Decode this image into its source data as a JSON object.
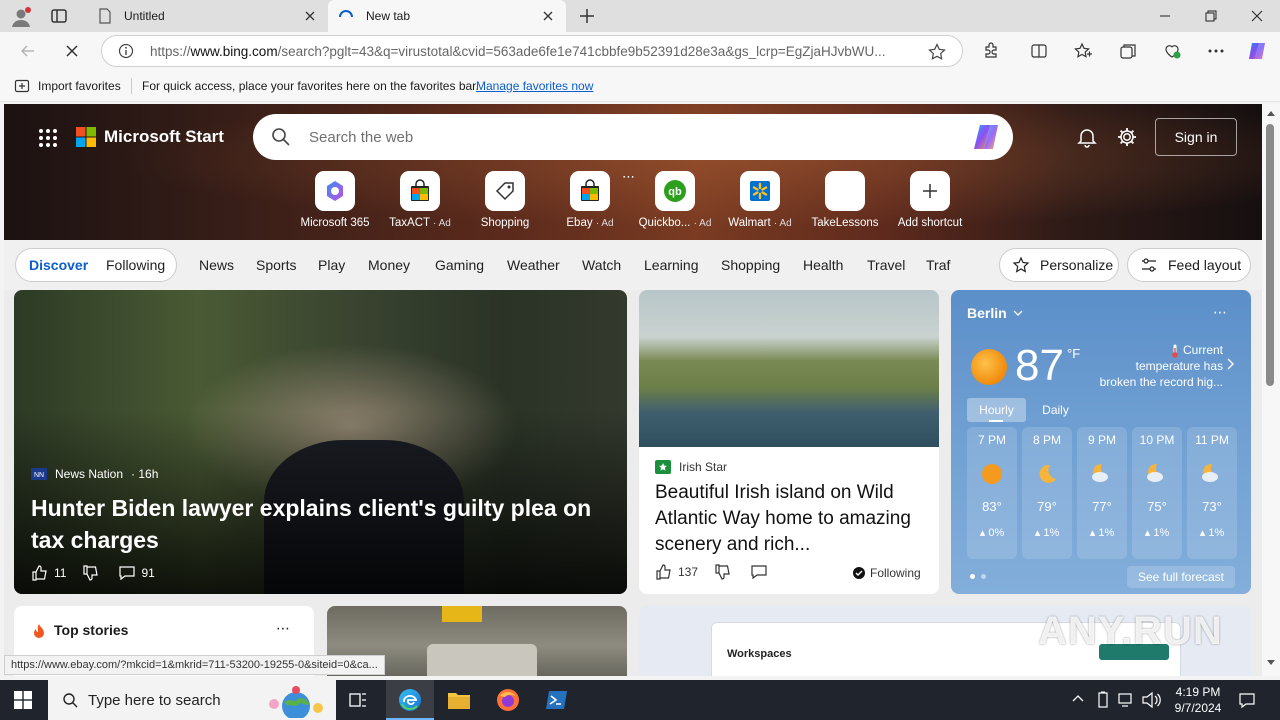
{
  "browser": {
    "tabs": [
      {
        "title": "Untitled"
      },
      {
        "title": "New tab"
      }
    ],
    "address": {
      "url_prefix": "https://",
      "url_host": "www.bing.com",
      "url_rest": "/search?pglt=43&q=virustotal&cvid=563ade6fe1e741cbbfe9b52391d28e3a&gs_lcrp=EgZjaHJvbWU..."
    },
    "favorites_bar": {
      "import_label": "Import favorites",
      "hint": "For quick access, place your favorites here on the favorites bar.",
      "manage_link": "Manage favorites now"
    },
    "status_url": "https://www.ebay.com/?mkcid=1&mkrid=711-53200-19255-0&siteid=0&ca..."
  },
  "header": {
    "brand": "Microsoft Start",
    "search_placeholder": "Search the web",
    "signin": "Sign in"
  },
  "shortcuts": [
    {
      "label": "Microsoft 365",
      "ad": ""
    },
    {
      "label": "TaxACT",
      "ad": "· Ad"
    },
    {
      "label": "Shopping",
      "ad": ""
    },
    {
      "label": "Ebay",
      "ad": "· Ad"
    },
    {
      "label": "Quickbo...",
      "ad": "· Ad"
    },
    {
      "label": "Walmart",
      "ad": "· Ad"
    },
    {
      "label": "TakeLessons",
      "ad": ""
    },
    {
      "label": "Add shortcut",
      "ad": ""
    }
  ],
  "nav": {
    "discover": "Discover",
    "following": "Following",
    "items": [
      "News",
      "Sports",
      "Play",
      "Money",
      "Gaming",
      "Weather",
      "Watch",
      "Learning",
      "Shopping",
      "Health",
      "Travel",
      "Traf"
    ],
    "personalize": "Personalize",
    "feed_layout": "Feed layout"
  },
  "main_story": {
    "source": "News Nation",
    "age": "· 16h",
    "headline": "Hunter Biden lawyer explains client's guilty plea on tax charges",
    "likes": "11",
    "comments": "91"
  },
  "side_story": {
    "source": "Irish Star",
    "headline": "Beautiful Irish island on Wild Atlantic Way home to amazing scenery and rich...",
    "likes": "137",
    "following": "Following"
  },
  "weather": {
    "city": "Berlin",
    "temp": "87",
    "unit": "°F",
    "alert_line1": "Current",
    "alert_line2": "temperature has",
    "alert_line3": "broken the record hig...",
    "tab_hourly": "Hourly",
    "tab_daily": "Daily",
    "hours": [
      {
        "time": "7 PM",
        "temp": "83°",
        "precip": "0%",
        "icon": "sun-icon"
      },
      {
        "time": "8 PM",
        "temp": "79°",
        "precip": "1%",
        "icon": "moon-icon"
      },
      {
        "time": "9 PM",
        "temp": "77°",
        "precip": "1%",
        "icon": "moon-cloud-icon"
      },
      {
        "time": "10 PM",
        "temp": "75°",
        "precip": "1%",
        "icon": "moon-cloud-icon"
      },
      {
        "time": "11 PM",
        "temp": "73°",
        "precip": "1%",
        "icon": "moon-cloud-icon"
      }
    ],
    "see_full": "See full forecast"
  },
  "top_stories": {
    "title": "Top stories"
  },
  "workspaces_card": {
    "title": "Workspaces"
  },
  "taskbar": {
    "search_placeholder": "Type here to search",
    "time": "4:19 PM",
    "date": "9/7/2024"
  },
  "watermark": "ANY.RUN",
  "colors": {
    "accent": "#0b5fcc",
    "weather_bg": "#6f9fd2",
    "taskbar": "#20242c"
  }
}
